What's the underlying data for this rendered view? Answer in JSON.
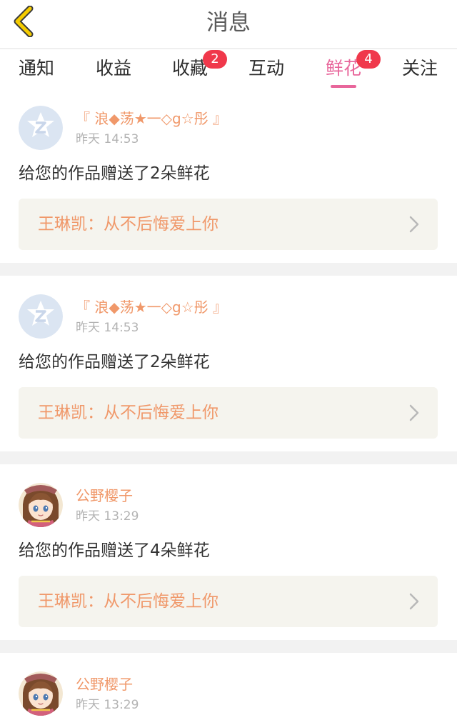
{
  "header": {
    "title": "消息",
    "back_icon": "back-chevron-icon",
    "accent": "#f2c200"
  },
  "tabs": [
    {
      "label": "通知",
      "badge": null,
      "active": false
    },
    {
      "label": "收益",
      "badge": null,
      "active": false
    },
    {
      "label": "收藏",
      "badge": "2",
      "active": false
    },
    {
      "label": "互动",
      "badge": null,
      "active": false
    },
    {
      "label": "鲜花",
      "badge": "4",
      "active": true
    },
    {
      "label": "关注",
      "badge": null,
      "active": false
    }
  ],
  "colors": {
    "active_tab": "#e8669b",
    "badge": "#f0384b",
    "username": "#f0986a",
    "link_bg": "#f5f4ee"
  },
  "feed": [
    {
      "username": "『 浪◆荡★一◇g☆彤 』",
      "time": "昨天 14:53",
      "message": "给您的作品赠送了2朵鲜花",
      "work_title": "王琳凯：从不后悔爱上你",
      "avatar": "default-avatar-icon"
    },
    {
      "username": "『 浪◆荡★一◇g☆彤 』",
      "time": "昨天 14:53",
      "message": "给您的作品赠送了2朵鲜花",
      "work_title": "王琳凯：从不后悔爱上你",
      "avatar": "default-avatar-icon"
    },
    {
      "username": "公野樱子",
      "time": "昨天 13:29",
      "message": "给您的作品赠送了4朵鲜花",
      "work_title": "王琳凯：从不后悔爱上你",
      "avatar": "anime-girl-avatar"
    },
    {
      "username": "公野樱子",
      "time": "昨天 13:29",
      "avatar": "anime-girl-avatar"
    }
  ]
}
